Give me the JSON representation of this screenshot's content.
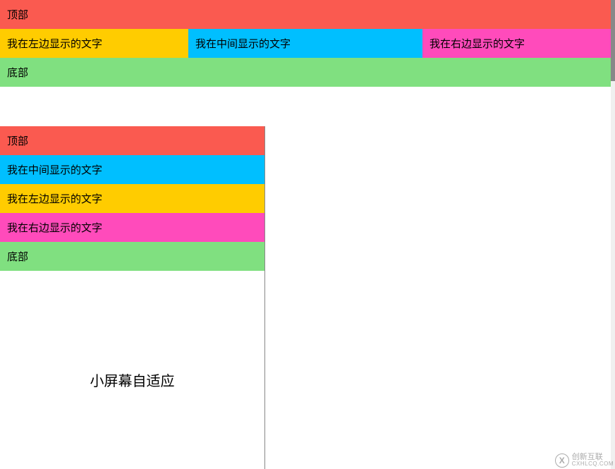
{
  "wide": {
    "top": "顶部",
    "left": "我在左边显示的文字",
    "middle": "我在中间显示的文字",
    "right": "我在右边显示的文字",
    "bottom": "底部"
  },
  "narrow": {
    "top": "顶部",
    "middle": "我在中间显示的文字",
    "left": "我在左边显示的文字",
    "right": "我在右边显示的文字",
    "bottom": "底部",
    "caption": "小屏幕自适应"
  },
  "logo": {
    "brand_cn": "创新互联",
    "brand_en": "CXHLCQ.COM"
  },
  "colors": {
    "top": "#fa5a50",
    "left": "#ffcc00",
    "middle": "#00bfff",
    "right": "#ff4bbb",
    "bottom": "#80e080"
  }
}
